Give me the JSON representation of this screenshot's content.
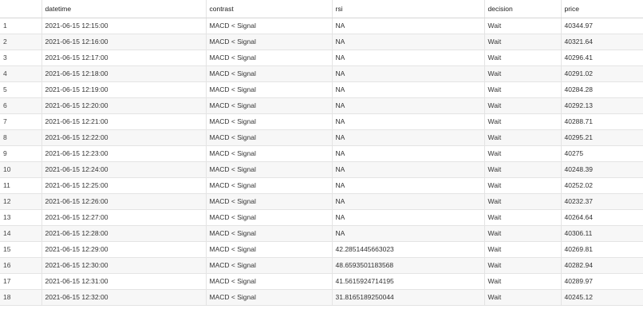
{
  "table": {
    "columns": [
      "",
      "datetime",
      "contrast",
      "rsi",
      "decision",
      "price"
    ],
    "rows": [
      [
        "1",
        "2021-06-15 12:15:00",
        "MACD < Signal",
        "NA",
        "Wait",
        "40344.97"
      ],
      [
        "2",
        "2021-06-15 12:16:00",
        "MACD < Signal",
        "NA",
        "Wait",
        "40321.64"
      ],
      [
        "3",
        "2021-06-15 12:17:00",
        "MACD < Signal",
        "NA",
        "Wait",
        "40296.41"
      ],
      [
        "4",
        "2021-06-15 12:18:00",
        "MACD < Signal",
        "NA",
        "Wait",
        "40291.02"
      ],
      [
        "5",
        "2021-06-15 12:19:00",
        "MACD < Signal",
        "NA",
        "Wait",
        "40284.28"
      ],
      [
        "6",
        "2021-06-15 12:20:00",
        "MACD < Signal",
        "NA",
        "Wait",
        "40292.13"
      ],
      [
        "7",
        "2021-06-15 12:21:00",
        "MACD < Signal",
        "NA",
        "Wait",
        "40288.71"
      ],
      [
        "8",
        "2021-06-15 12:22:00",
        "MACD < Signal",
        "NA",
        "Wait",
        "40295.21"
      ],
      [
        "9",
        "2021-06-15 12:23:00",
        "MACD < Signal",
        "NA",
        "Wait",
        "40275"
      ],
      [
        "10",
        "2021-06-15 12:24:00",
        "MACD < Signal",
        "NA",
        "Wait",
        "40248.39"
      ],
      [
        "11",
        "2021-06-15 12:25:00",
        "MACD < Signal",
        "NA",
        "Wait",
        "40252.02"
      ],
      [
        "12",
        "2021-06-15 12:26:00",
        "MACD < Signal",
        "NA",
        "Wait",
        "40232.37"
      ],
      [
        "13",
        "2021-06-15 12:27:00",
        "MACD < Signal",
        "NA",
        "Wait",
        "40264.64"
      ],
      [
        "14",
        "2021-06-15 12:28:00",
        "MACD < Signal",
        "NA",
        "Wait",
        "40306.11"
      ],
      [
        "15",
        "2021-06-15 12:29:00",
        "MACD < Signal",
        "42.2851445663023",
        "Wait",
        "40269.81"
      ],
      [
        "16",
        "2021-06-15 12:30:00",
        "MACD < Signal",
        "48.6593501183568",
        "Wait",
        "40282.94"
      ],
      [
        "17",
        "2021-06-15 12:31:00",
        "MACD < Signal",
        "41.5615924714195",
        "Wait",
        "40289.97"
      ],
      [
        "18",
        "2021-06-15 12:32:00",
        "MACD < Signal",
        "31.8165189250044",
        "Wait",
        "40245.12"
      ]
    ]
  }
}
